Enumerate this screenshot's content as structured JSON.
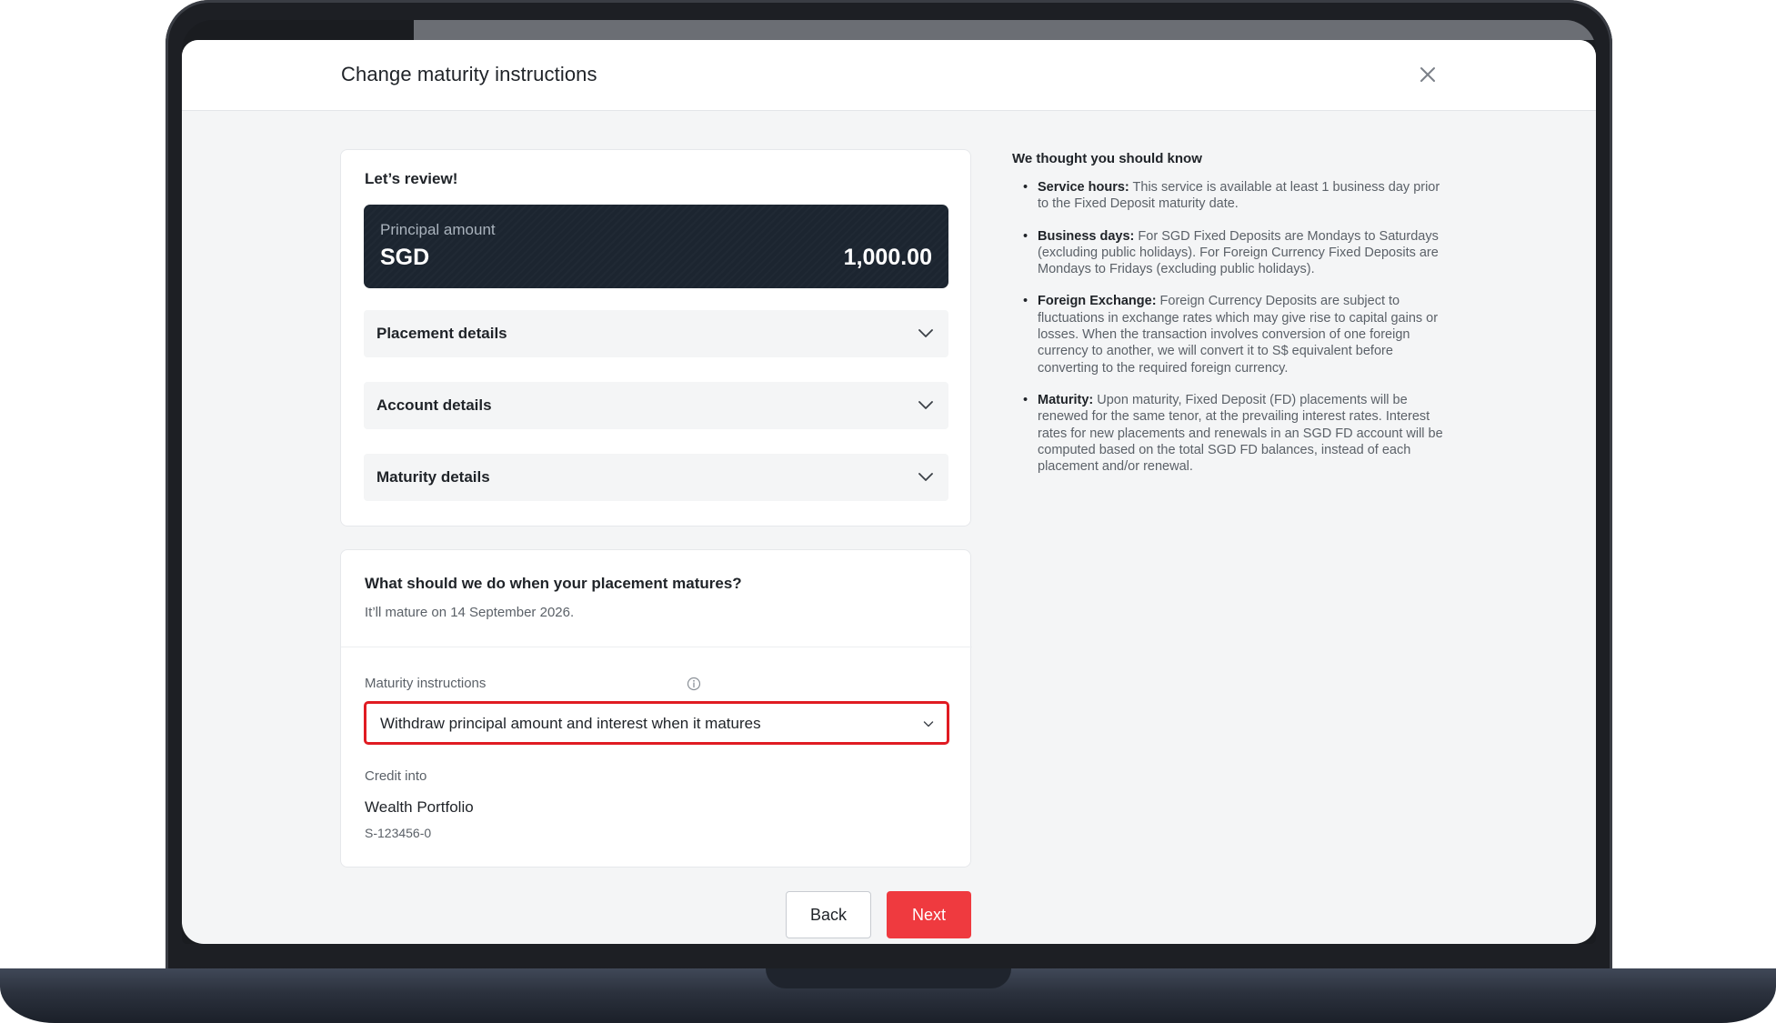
{
  "modal": {
    "title": "Change maturity instructions"
  },
  "review": {
    "title": "Let’s review!",
    "principal_label": "Principal amount",
    "currency": "SGD",
    "amount": "1,000.00",
    "sections": [
      {
        "label": "Placement details"
      },
      {
        "label": "Account details"
      },
      {
        "label": "Maturity details"
      }
    ]
  },
  "maturity": {
    "question": "What should we do when your placement matures?",
    "subtitle": "It’ll mature on 14 September 2026.",
    "instructions_label": "Maturity instructions",
    "selected_instruction": "Withdraw principal amount and interest when it matures",
    "credit_label": "Credit into",
    "credit_account_name": "Wealth Portfolio",
    "credit_account_number": "S-123456-0",
    "highlight_color": "#e01b22"
  },
  "buttons": {
    "back": "Back",
    "next": "Next",
    "next_color": "#ef3a3f"
  },
  "info": {
    "title": "We thought you should know",
    "items": [
      {
        "term": "Service hours:",
        "text": " This service is available at least 1 business day prior to the Fixed Deposit maturity date."
      },
      {
        "term": "Business days:",
        "text": " For SGD Fixed Deposits are Mondays to Saturdays (excluding public holidays). For Foreign Currency Fixed Deposits are Mondays to Fridays (excluding public holidays)."
      },
      {
        "term": "Foreign Exchange:",
        "text": " Foreign Currency Deposits are subject to fluctuations in exchange rates which may give rise to capital gains or losses. When the transaction involves conversion of one foreign currency to another, we will convert it to S$ equivalent before converting to the required foreign currency."
      },
      {
        "term": "Maturity:",
        "text": " Upon maturity, Fixed Deposit (FD) placements will be renewed for the same tenor, at the prevailing interest rates. Interest rates for new placements and renewals in an SGD FD account will be computed based on the total SGD FD balances, instead of each placement and/or renewal."
      }
    ]
  }
}
